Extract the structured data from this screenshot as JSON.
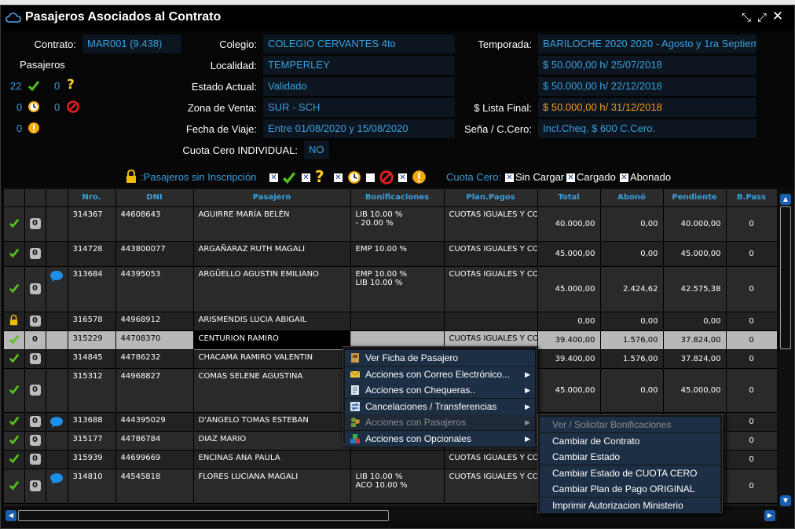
{
  "window": {
    "title": "Pasajeros Asociados al Contrato"
  },
  "info": {
    "contrato_label": "Contrato:",
    "contrato": "MAR001 (9.438)",
    "colegio_label": "Colegio:",
    "colegio": "COLEGIO CERVANTES 4to",
    "localidad_label": "Localidad:",
    "localidad": "TEMPERLEY",
    "estado_label": "Estado Actual:",
    "estado": "Validado",
    "zona_label": "Zona de Venta:",
    "zona": "SUR - SCH",
    "fecha_label": "Fecha de Viaje:",
    "fecha": "Entre 01/08/2020 y 15/08/2020",
    "cuota_label": "Cuota Cero INDIVIDUAL:",
    "cuota": "NO",
    "temporada_label": "Temporada:",
    "temporada": "BARILOCHE 2020 2020 - Agosto y 1ra Septiem",
    "precio1": "$ 50.000,00 h/ 25/07/2018",
    "precio2": "$ 50.000,00 h/ 22/12/2018",
    "lista_label": "$ Lista Final:",
    "lista": "$ 50.000,00 h/ 31/12/2018",
    "sena_label": "Seña / C.Cero:",
    "sena": "Incl.Cheq. $ 600 C.Cero."
  },
  "pasajeros": {
    "title": "Pasajeros",
    "ok": "22",
    "pending": "0",
    "clock": "0",
    "blocked": "0",
    "warn": "0"
  },
  "legend": {
    "sin_inscripcion": ":Pasajeros sin Inscripción",
    "cuota_cero": "Cuota Cero:",
    "sin_cargar": "Sin Cargar",
    "cargado": "Cargado",
    "abonado": "Abonado"
  },
  "table": {
    "headers": [
      "",
      "",
      "",
      "Nro.",
      "DNI",
      "Pasajero",
      "Bonificaciones",
      "Plan.Pagos",
      "Total",
      "Abonó",
      "Pendiente",
      "B.Pass"
    ],
    "rows": [
      {
        "status": "check",
        "badge": "0",
        "comment": false,
        "nro": "314367",
        "dni": "44608643",
        "name": "AGUIRRE MARÍA BELÉN",
        "bon": [
          "LIB 10.00 %",
          "- 20.00 %"
        ],
        "plan": "CUOTAS IGUALES Y CO",
        "total": "40.000,00",
        "abono": "0,00",
        "pend": "40.000,00",
        "bpass": "0"
      },
      {
        "status": "check",
        "badge": "0",
        "comment": false,
        "nro": "314728",
        "dni": "443800077",
        "name": "ARGAÑARAZ RUTH MAGALI",
        "bon": [
          "EMP 10.00 %"
        ],
        "plan": "CUOTAS IGUALES Y CO",
        "total": "45.000,00",
        "abono": "0,00",
        "pend": "45.000,00",
        "bpass": "0"
      },
      {
        "status": "check",
        "badge": "0",
        "comment": true,
        "nro": "313684",
        "dni": "44395053",
        "name": "ARGÜELLO AGUSTIN EMILIANO",
        "bon": [
          "EMP 10.00 %",
          "LIB 10.00 %"
        ],
        "plan": "CUOTAS IGUALES Y CO",
        "total": "45.000,00",
        "abono": "2.424,62",
        "pend": "42.575,38",
        "bpass": "0"
      },
      {
        "status": "lock",
        "badge": "0",
        "comment": false,
        "nro": "316578",
        "dni": "44968912",
        "name": "ARISMENDIS LUCIA ABIGAIL",
        "bon": [],
        "plan": "",
        "total": "0,00",
        "abono": "0,00",
        "pend": "0,00",
        "bpass": "0"
      },
      {
        "status": "check",
        "badge": "0",
        "comment": false,
        "nro": "315229",
        "dni": "44708370",
        "name": "CENTURION RAMIRO",
        "bon": [],
        "plan": "CUOTAS IGUALES Y CO",
        "total": "39.400,00",
        "abono": "1.576,00",
        "pend": "37.824,00",
        "bpass": "0",
        "selected": true
      },
      {
        "status": "check",
        "badge": "0",
        "comment": false,
        "nro": "314845",
        "dni": "44786232",
        "name": "CHACAMA RAMIRO VALENTIN",
        "bon": [],
        "plan": "",
        "total": "39.400,00",
        "abono": "1.576,00",
        "pend": "37.824,00",
        "bpass": "0"
      },
      {
        "status": "check",
        "badge": "0",
        "comment": false,
        "nro": "315312",
        "dni": "44968827",
        "name": "COMAS SELENE AGUSTINA",
        "bon": [],
        "plan": "",
        "total": "45.000,00",
        "abono": "0,00",
        "pend": "45.000,00",
        "bpass": "0"
      },
      {
        "status": "check",
        "badge": "0",
        "comment": true,
        "nro": "313688",
        "dni": "444395029",
        "name": "D'ANGELO TOMAS ESTEBAN",
        "bon": [],
        "plan": "",
        "total": "",
        "abono": "",
        "pend": "",
        "bpass": "0"
      },
      {
        "status": "check",
        "badge": "0",
        "comment": false,
        "nro": "315177",
        "dni": "44786784",
        "name": "DIAZ MARIO",
        "bon": [],
        "plan": "",
        "total": "",
        "abono": "",
        "pend": "",
        "bpass": "0"
      },
      {
        "status": "check",
        "badge": "0",
        "comment": false,
        "nro": "315939",
        "dni": "44699669",
        "name": "ENCINAS ANA PAULA",
        "bon": [],
        "plan": "CUOTAS IGUALES Y CO",
        "total": "",
        "abono": "",
        "pend": "",
        "bpass": "0"
      },
      {
        "status": "check",
        "badge": "0",
        "comment": true,
        "nro": "314810",
        "dni": "44545818",
        "name": "FLORES LUCIANA MAGALI",
        "bon": [
          "LIB 10.00 %",
          "ACO 10.00 %"
        ],
        "plan": "CUOTAS IGUALES Y CO",
        "total": "",
        "abono": "",
        "pend": "",
        "bpass": "0"
      }
    ]
  },
  "context_menu": {
    "items": [
      {
        "label": "Ver Ficha de Pasajero",
        "icon": "passenger-card-icon",
        "arrow": false,
        "disabled": false
      },
      {
        "label": "Acciones con Correo Electrónico...",
        "icon": "envelope-icon",
        "arrow": true,
        "disabled": false
      },
      {
        "label": "Acciones con Chequeras..",
        "icon": "checkbook-icon",
        "arrow": true,
        "disabled": false
      },
      {
        "label": "Cancelaciones / Transferencias",
        "icon": "transfer-icon",
        "arrow": true,
        "disabled": false
      },
      {
        "label": "Acciones con Pasajeros",
        "icon": "passengers-icon",
        "arrow": true,
        "disabled": true
      },
      {
        "label": "Acciones con Opcionales",
        "icon": "options-icon",
        "arrow": true,
        "disabled": false
      }
    ]
  },
  "submenu": {
    "items": [
      {
        "label": "Ver / Solicitar Bonificaciones",
        "disabled": true
      },
      {
        "label": "Cambiar de Contrato",
        "disabled": false
      },
      {
        "label": "Cambiar Estado",
        "disabled": false
      },
      {
        "label": "Cambiar Estado de CUOTA CERO",
        "disabled": false
      },
      {
        "label": "Cambiar Plan de Pago ORIGINAL",
        "disabled": false
      },
      {
        "label": "Imprimir Autorizacion Ministerio",
        "disabled": false
      }
    ]
  },
  "colors": {
    "accent": "#3aa0de",
    "orange": "#f39a22",
    "check": "#5ac01e",
    "menu": "#1d2f45"
  }
}
